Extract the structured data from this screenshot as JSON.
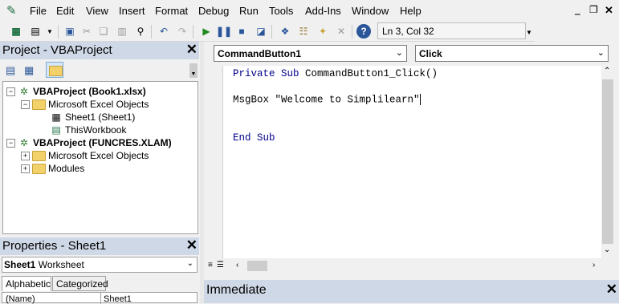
{
  "menubar": {
    "items": [
      "File",
      "Edit",
      "View",
      "Insert",
      "Format",
      "Debug",
      "Run",
      "Tools",
      "Add-Ins",
      "Window",
      "Help"
    ],
    "window_controls": [
      "minimize",
      "restore",
      "close"
    ]
  },
  "toolbar": {
    "icons": [
      "excel-view-icon",
      "insert-userform-icon",
      "save-icon",
      "cut-icon",
      "copy-icon",
      "paste-icon",
      "find-icon",
      "undo-icon",
      "redo-icon",
      "run-icon",
      "break-icon",
      "reset-icon",
      "design-mode-icon",
      "project-explorer-icon",
      "properties-icon",
      "object-browser-icon",
      "toolbox-icon",
      "help-icon"
    ],
    "position_text": "Ln 3, Col 32"
  },
  "project": {
    "title": "Project - VBAProject",
    "tree": [
      {
        "label": "VBAProject (Book1.xlsx)",
        "bold": true
      },
      {
        "label": "Microsoft Excel Objects"
      },
      {
        "label": "Sheet1 (Sheet1)"
      },
      {
        "label": "ThisWorkbook"
      },
      {
        "label": "VBAProject (FUNCRES.XLAM)",
        "bold": true
      },
      {
        "label": "Microsoft Excel Objects"
      },
      {
        "label": "Modules"
      }
    ]
  },
  "properties": {
    "title": "Properties - Sheet1",
    "object_name": "Sheet1",
    "object_type": "Worksheet",
    "tabs": [
      "Alphabetic",
      "Categorized"
    ],
    "row_name": "(Name)",
    "row_value": "Sheet1"
  },
  "code": {
    "object_combo": "CommandButton1",
    "proc_combo": "Click",
    "lines": [
      {
        "kw1": "Private Sub",
        "rest": " CommandButton1_Click()"
      },
      {
        "text": "MsgBox \"Welcome to Simplilearn\""
      },
      {
        "kw1": "End Sub"
      }
    ]
  },
  "immediate": {
    "title": "Immediate"
  }
}
